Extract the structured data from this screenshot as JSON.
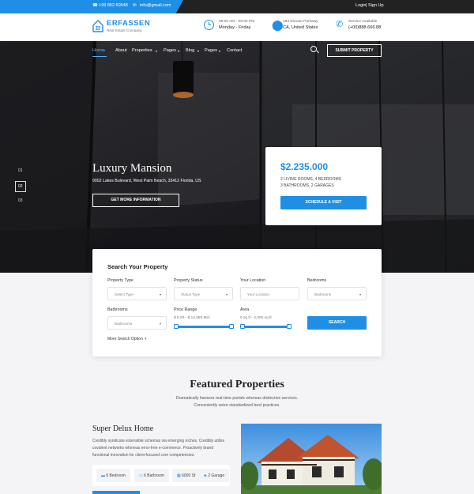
{
  "topbar": {
    "phone": "+99 852 60548",
    "email": "info@gmail.com",
    "login": "Login",
    "sep": "|",
    "signup": "Sign Up"
  },
  "brand": {
    "name": "ERFASSEN",
    "tagline": "Real Estate Company"
  },
  "header_info": [
    {
      "line1": "08:00 AM - 06:00 PM",
      "line2": "Monday - Friday"
    },
    {
      "line1": "183 Donato Parkway",
      "line2": "CA, United States"
    },
    {
      "line1": "Service Available",
      "line2": "(+00)888.666.88"
    }
  ],
  "nav": {
    "items": [
      "Home",
      "About",
      "Properties",
      "Pages",
      "Blog",
      "Pages",
      "Contact"
    ],
    "active": "Home",
    "submit": "SUBMIT PROPERTY"
  },
  "hero": {
    "title": "Luxury Mansion",
    "address": "9002 Lakes Bulevard, West Palm Beach, 33412 Florida, US",
    "cta": "GET MORE INFORMATION",
    "slides": [
      "01",
      "02",
      "03"
    ],
    "active_slide": "02",
    "price": "$2.235.000",
    "features_line1": "2 LIVING ROOMS, 4 BEDROOMS",
    "features_line2": "3 BATHROOMS, 2 GARAGES",
    "visit": "SCHEDULE A VISIT"
  },
  "search": {
    "title": "Search Your Property",
    "fields": [
      {
        "label": "Property Type",
        "value": "Select Type"
      },
      {
        "label": "Property Status",
        "value": "Status Type"
      },
      {
        "label": "Your Location",
        "value": "Your Location"
      },
      {
        "label": "Bedrooms",
        "value": "Bedrooms"
      },
      {
        "label": "Bathrooms",
        "value": "Bathrooms"
      }
    ],
    "price": {
      "label": "Price Range",
      "value": "$ 0.00 - $ 14,980,852"
    },
    "area": {
      "label": "Area",
      "value": "0 sq ft - 2,000 sq ft"
    },
    "button": "SEARCH",
    "more": "More Search Option"
  },
  "featured": {
    "title": "Featured Properties",
    "sub1": "Dramatically harness real-time portals whereas distinctive services.",
    "sub2": "Conveniently seize standardized best practices."
  },
  "listing": {
    "title": "Super Delux Home",
    "desc1": "Credibly syndicate extensible schemas via emerging niches. Credibly utilize",
    "desc2": "covalent networks whereas error-free e-commerce. Proactively brand",
    "desc3": "functional innovation for client-focused core competencies.",
    "features": [
      "6 Bedroom",
      "6 Bathroom",
      "6000 Sf",
      "2 Garage"
    ]
  },
  "colors": {
    "accent": "#1f8fe6",
    "dark": "#222222"
  }
}
